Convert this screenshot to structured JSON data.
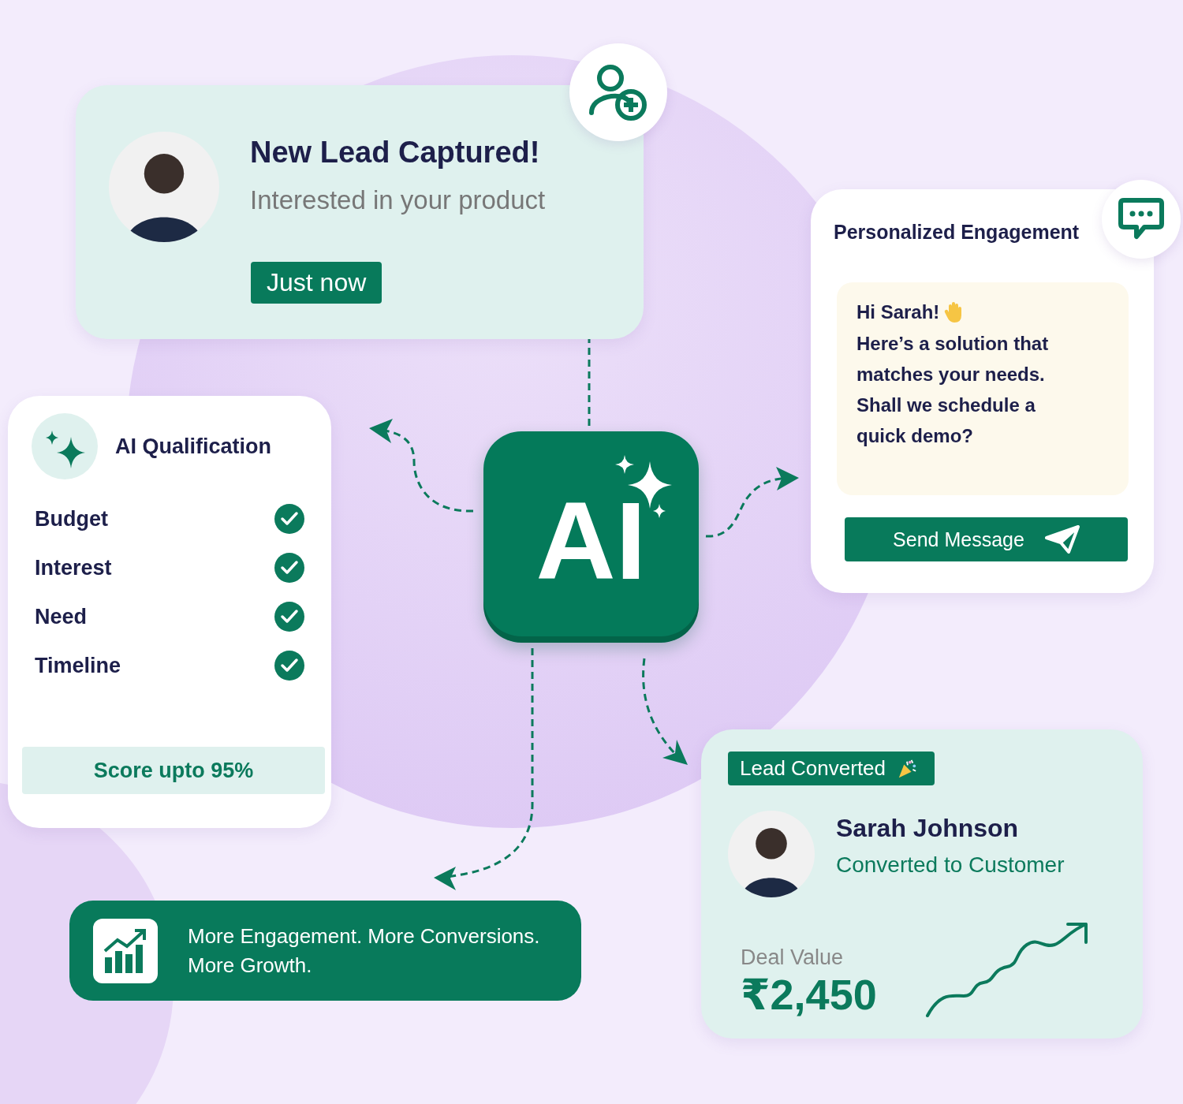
{
  "lead_card": {
    "title": "New Lead Captured!",
    "subtitle": "Interested in your product",
    "time_badge": "Just now"
  },
  "qualification_card": {
    "title": "AI Qualification",
    "criteria": [
      {
        "label": "Budget",
        "checked": true
      },
      {
        "label": "Interest",
        "checked": true
      },
      {
        "label": "Need",
        "checked": true
      },
      {
        "label": "Timeline",
        "checked": true
      }
    ],
    "score": "Score upto 95%"
  },
  "ai_tile": {
    "label": "AI"
  },
  "engagement_card": {
    "title": "Personalized Engagement",
    "greeting": "Hi Sarah!",
    "message": "Here’s a solution that matches your needs. Shall we schedule a quick demo?",
    "button": "Send Message"
  },
  "converted_card": {
    "badge": "Lead Converted",
    "name": "Sarah Johnson",
    "status": "Converted to Customer",
    "deal_label": "Deal Value",
    "deal_value": "₹2,450"
  },
  "banner": {
    "lines": [
      "More Engagement. More Conversions.",
      "More Growth."
    ]
  }
}
